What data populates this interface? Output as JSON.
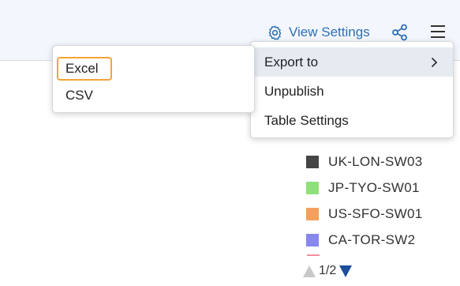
{
  "toolbar": {
    "view_settings_label": "View Settings",
    "icons": [
      "gear-icon",
      "share-icon",
      "hamburger-menu-icon"
    ]
  },
  "main_menu": {
    "items": [
      {
        "label": "Export to",
        "has_submenu": true,
        "active": true
      },
      {
        "label": "Unpublish"
      },
      {
        "label": "Table Settings"
      }
    ]
  },
  "export_submenu": {
    "items": [
      {
        "label": "Excel",
        "highlighted": true
      },
      {
        "label": "CSV"
      }
    ]
  },
  "legend": {
    "items": [
      {
        "label": "UK-LON-SW03",
        "color": "#454545"
      },
      {
        "label": "JP-TYO-SW01",
        "color": "#8ee07a"
      },
      {
        "label": "US-SFO-SW01",
        "color": "#f5a15c"
      },
      {
        "label": "CA-TOR-SW2",
        "color": "#8787ee"
      }
    ],
    "pager": "1/2"
  },
  "colors": {
    "accent": "#2d6fb4",
    "highlight_outline": "#f5a33a"
  }
}
